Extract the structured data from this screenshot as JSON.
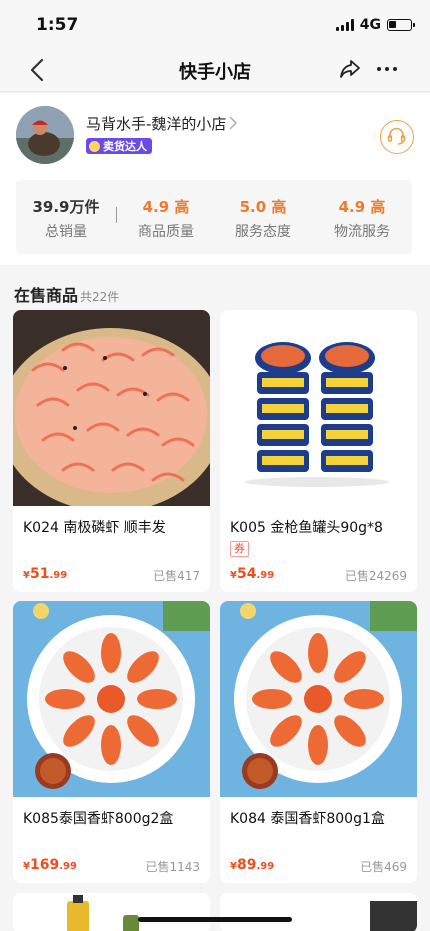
{
  "status_bar": {
    "time": "1:57",
    "network": "4G"
  },
  "navbar": {
    "title": "快手小店"
  },
  "shop": {
    "name": "马背水手-魏洋的小店",
    "badge": "卖货达人",
    "stats": [
      {
        "value": "39.9万件",
        "label": "总销量",
        "color": "#333333"
      },
      {
        "value": "4.9 高",
        "label": "商品质量",
        "color": "#f07a2a"
      },
      {
        "value": "5.0 高",
        "label": "服务态度",
        "color": "#f07a2a"
      },
      {
        "value": "4.9 高",
        "label": "物流服务",
        "color": "#f07a2a"
      }
    ]
  },
  "section": {
    "title": "在售商品",
    "count": "共22件"
  },
  "products": [
    {
      "name": "K024 南极磷虾 顺丰发",
      "currency": "¥",
      "price_int": "51",
      "price_dec": ".99",
      "sold": "已售417",
      "coupon": ""
    },
    {
      "name": "K005 金枪鱼罐头90g*8",
      "currency": "¥",
      "price_int": "54",
      "price_dec": ".99",
      "sold": "已售24269",
      "coupon": "券"
    },
    {
      "name": "K085泰国香虾800g2盒",
      "currency": "¥",
      "price_int": "169",
      "price_dec": ".99",
      "sold": "已售1143",
      "coupon": ""
    },
    {
      "name": "K084 泰国香虾800g1盒",
      "currency": "¥",
      "price_int": "89",
      "price_dec": ".99",
      "sold": "已售469",
      "coupon": ""
    }
  ],
  "colors": {
    "accent": "#f07a2a",
    "price": "#f04d1d",
    "badge": "#6a4be8"
  }
}
